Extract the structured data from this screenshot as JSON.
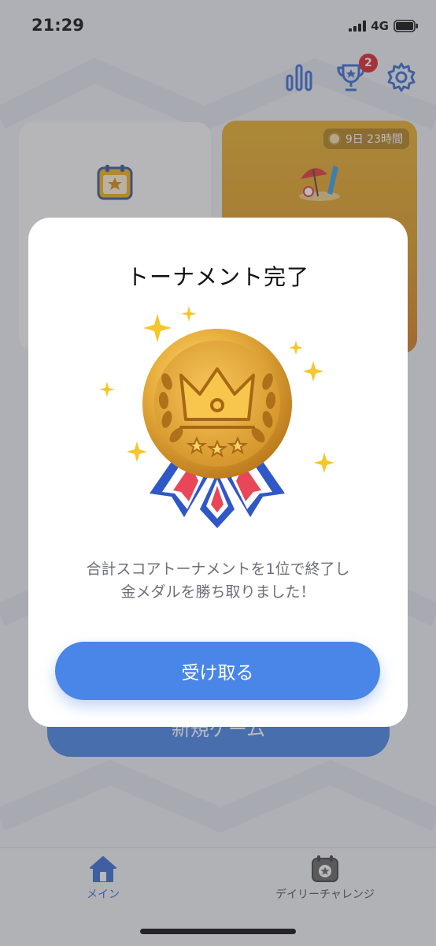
{
  "status_bar": {
    "time": "21:29",
    "network": "4G",
    "icons": [
      "signal-icon",
      "battery-icon"
    ]
  },
  "header": {
    "stats_icon": "bar-chart-icon",
    "trophy_icon": "trophy-icon",
    "trophy_badge": "2",
    "settings_icon": "gear-icon",
    "badge_color": "#e0262c"
  },
  "cards": {
    "daily": {
      "icon": "calendar-star-icon"
    },
    "event": {
      "timer": "9日 23時間",
      "icon": "beach-umbrella-icon"
    }
  },
  "main": {
    "new_game_label": "新規ゲーム"
  },
  "modal": {
    "title": "トーナメント完了",
    "medal_icon": "gold-medal-icon",
    "message_line1": "合計スコアトーナメントを1位で終了し",
    "message_line2": "金メダルを勝ち取りました！",
    "button_label": "受け取る",
    "accent_color": "#4a86e8"
  },
  "tab_bar": {
    "tabs": [
      {
        "label": "メイン",
        "icon": "home-icon",
        "active": true
      },
      {
        "label": "デイリーチャレンジ",
        "icon": "calendar-star-icon",
        "active": false
      }
    ]
  }
}
